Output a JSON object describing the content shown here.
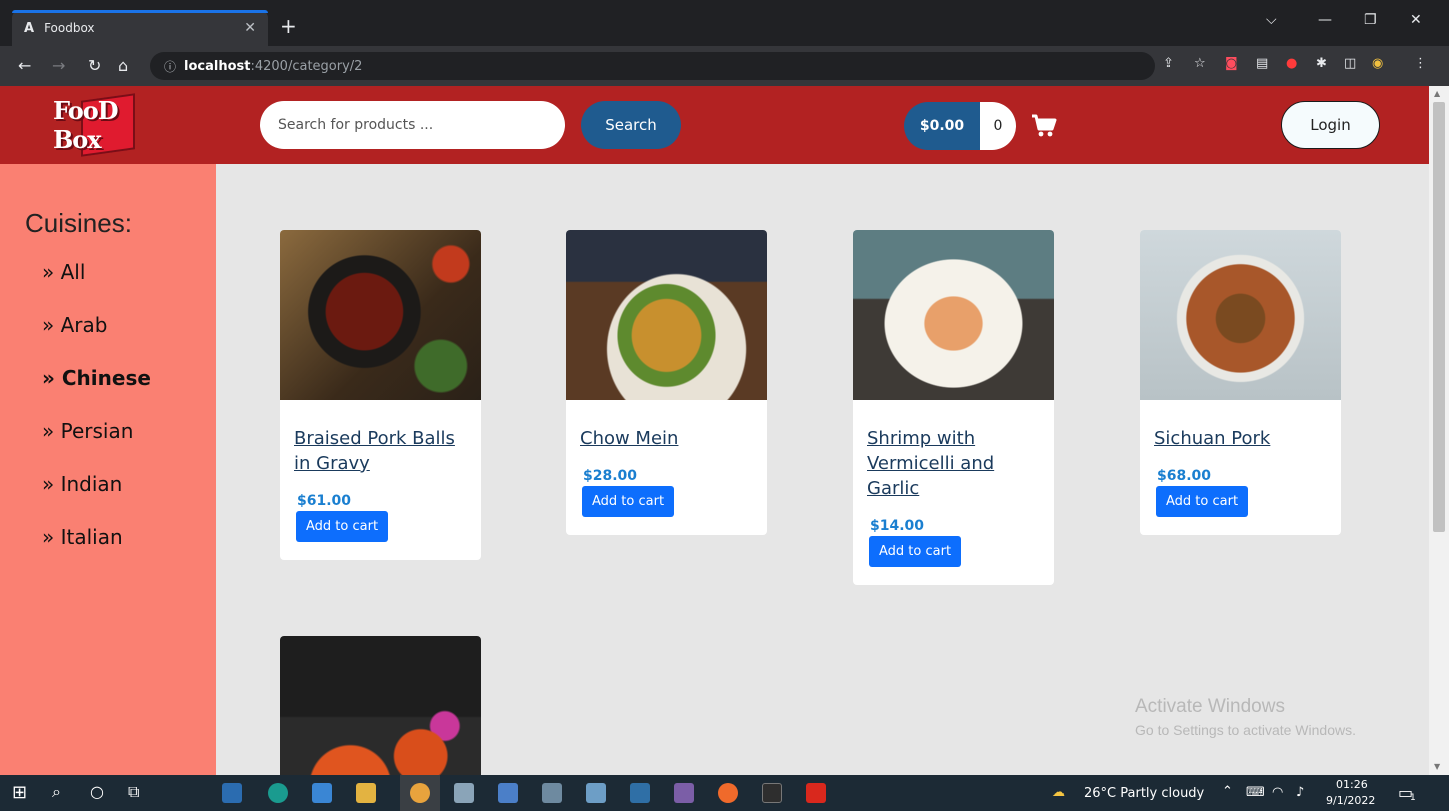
{
  "browser": {
    "tab_title": "Foodbox",
    "tab_favicon": "A",
    "url_host": "localhost",
    "url_path": ":4200/category/2"
  },
  "header": {
    "logo_text": "FooD Box",
    "search_placeholder": "Search for products ...",
    "search_label": "Search",
    "cart_total": "$0.00",
    "cart_count": "0",
    "login_label": "Login"
  },
  "sidebar": {
    "title": "Cuisines:",
    "items": [
      {
        "label": "» All"
      },
      {
        "label": "» Arab"
      },
      {
        "label": "» Chinese",
        "active": true
      },
      {
        "label": "» Persian"
      },
      {
        "label": "» Indian"
      },
      {
        "label": "» Italian"
      }
    ]
  },
  "products": [
    {
      "name": "Braised Pork Balls in Gravy",
      "price": "$61.00",
      "add_label": "Add to cart"
    },
    {
      "name": "Chow Mein",
      "price": "$28.00",
      "add_label": "Add to cart"
    },
    {
      "name": "Shrimp with Vermicelli and Garlic",
      "price": "$14.00",
      "add_label": "Add to cart"
    },
    {
      "name": "Sichuan Pork",
      "price": "$68.00",
      "add_label": "Add to cart"
    }
  ],
  "watermark": {
    "line1": "Activate Windows",
    "line2": "Go to Settings to activate Windows."
  },
  "taskbar": {
    "weather": "26°C  Partly cloudy",
    "time": "01:26",
    "date": "9/1/2022",
    "notification_count": "1"
  },
  "colors": {
    "header": "#b22222",
    "sidebar": "#fa8072",
    "primary_button": "#0d6efd",
    "search_button": "#1f5b8f"
  }
}
